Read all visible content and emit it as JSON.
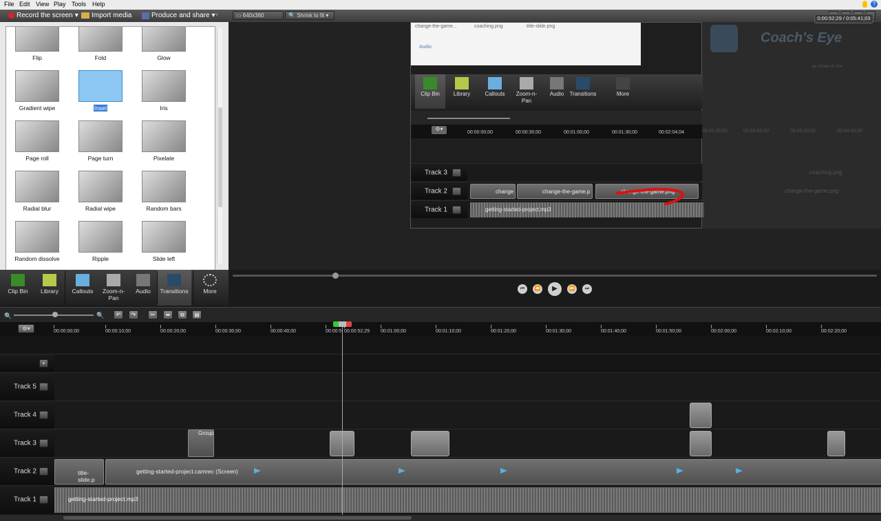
{
  "menu": [
    "File",
    "Edit",
    "View",
    "Play",
    "Tools",
    "Help"
  ],
  "toolbar": {
    "record": "Record the screen",
    "import": "Import media",
    "produce": "Produce and share"
  },
  "preview_bar": {
    "size": "640x360",
    "fit": "Shrink to fit"
  },
  "transitions": [
    {
      "label": "Flip"
    },
    {
      "label": "Fold"
    },
    {
      "label": "Glow"
    },
    {
      "label": "Gradient wipe"
    },
    {
      "label": "Inset",
      "selected": true
    },
    {
      "label": "Iris"
    },
    {
      "label": "Page roll"
    },
    {
      "label": "Page turn"
    },
    {
      "label": "Pixelate"
    },
    {
      "label": "Radial blur"
    },
    {
      "label": "Radial wipe"
    },
    {
      "label": "Random bars"
    },
    {
      "label": "Random dissolve"
    },
    {
      "label": "Ripple"
    },
    {
      "label": "Slide left"
    }
  ],
  "tabs": [
    {
      "label": "Clip Bin",
      "icon": "film-icon"
    },
    {
      "label": "Library",
      "icon": "library-icon"
    },
    {
      "label": "Callouts",
      "icon": "callout-icon"
    },
    {
      "label": "Zoom-n-\nPan",
      "icon": "zoom-icon"
    },
    {
      "label": "Audio",
      "icon": "audio-icon"
    },
    {
      "label": "Transitions",
      "icon": "transitions-icon",
      "active": true
    },
    {
      "label": "More",
      "icon": "more-icon"
    }
  ],
  "embedded": {
    "files": [
      "change-the-game...",
      "coaching.png",
      "title-slide.png"
    ],
    "audio_label": "Audio",
    "tabs": [
      "Clip Bin",
      "Library",
      "Callouts",
      "Zoom-n-\nPan",
      "Audio",
      "Transitions",
      "More"
    ],
    "ruler": [
      "00:00:00;00",
      "00:00:30;00",
      "00:01:00;00",
      "00:01:30;00",
      "00:02:04;04"
    ],
    "tracks": [
      {
        "name": "Track 3",
        "clips": []
      },
      {
        "name": "Track 2",
        "clips": [
          "change",
          "change-the-game.p",
          "change-the-game.png"
        ]
      },
      {
        "name": "Track 1",
        "clips": [
          "getting-started-project.mp3"
        ]
      }
    ],
    "ghost_title": "Coach's Eye",
    "ghost_clips": [
      "coaching.png",
      "change-the-game.png"
    ],
    "ghost_ruler": [
      "00:02:30;00",
      "00:03:00;00",
      "00:03:30;00",
      "00:04:00;00"
    ],
    "ghost_caption": "as shown on the"
  },
  "playback": {
    "timecode": "0:00:52;29 / 0:05:41;03"
  },
  "timeline": {
    "ruler": [
      "00:00:00;00",
      "00:00:10;00",
      "00:00:20;00",
      "00:00:30;00",
      "00:00:40;00",
      "00:00:5",
      "00:00:52;29",
      "00:01:00;00",
      "00:01:10;00",
      "00:01:20;00",
      "00:01:30;00",
      "00:01:40;00",
      "00:01:50;00",
      "00:02:00;00",
      "00:02:10;00",
      "00:02:20;00"
    ],
    "tracks": [
      {
        "name": "Track 5"
      },
      {
        "name": "Track 4"
      },
      {
        "name": "Track 3",
        "group": "Group"
      },
      {
        "name": "Track 2",
        "clips": [
          "title-slide.p",
          "getting-started-project.camrec (Screen)"
        ]
      },
      {
        "name": "Track 1",
        "clips": [
          "getting-started-project.mp3"
        ]
      }
    ]
  }
}
